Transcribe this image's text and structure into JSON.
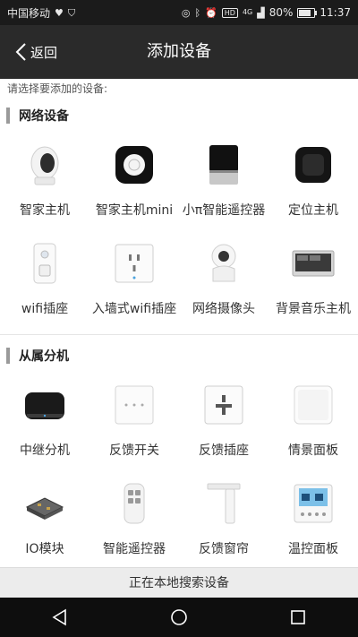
{
  "status_bar": {
    "carrier": "中国移动",
    "battery": "80%",
    "battery_level": 0.8,
    "time": "11:37",
    "network": "4G",
    "hd": "HD"
  },
  "header": {
    "back_label": "返回",
    "title": "添加设备"
  },
  "hint": "请选择要添加的设备:",
  "sections": [
    {
      "title": "网络设备",
      "items": [
        {
          "label": "智家主机",
          "icon": "hub-speaker-icon"
        },
        {
          "label": "智家主机mini",
          "icon": "mini-hub-icon"
        },
        {
          "label": "小π智能遥控器",
          "icon": "ir-remote-icon"
        },
        {
          "label": "定位主机",
          "icon": "locator-hub-icon"
        },
        {
          "label": "wifi插座",
          "icon": "wifi-plug-icon"
        },
        {
          "label": "入墙式wifi插座",
          "icon": "wall-socket-icon"
        },
        {
          "label": "网络摄像头",
          "icon": "camera-icon"
        },
        {
          "label": "背景音乐主机",
          "icon": "music-panel-icon"
        }
      ]
    },
    {
      "title": "从属分机",
      "items": [
        {
          "label": "中继分机",
          "icon": "repeater-icon"
        },
        {
          "label": "反馈开关",
          "icon": "switch-panel-icon"
        },
        {
          "label": "反馈插座",
          "icon": "feedback-socket-icon"
        },
        {
          "label": "情景面板",
          "icon": "scene-panel-icon"
        },
        {
          "label": "IO模块",
          "icon": "io-module-icon"
        },
        {
          "label": "智能遥控器",
          "icon": "key-fob-icon"
        },
        {
          "label": "反馈窗帘",
          "icon": "curtain-motor-icon"
        },
        {
          "label": "温控面板",
          "icon": "thermostat-icon"
        }
      ]
    }
  ],
  "search_status": "正在本地搜索设备",
  "nav": {
    "back": "back-triangle-icon",
    "home": "home-circle-icon",
    "recent": "recent-square-icon"
  }
}
